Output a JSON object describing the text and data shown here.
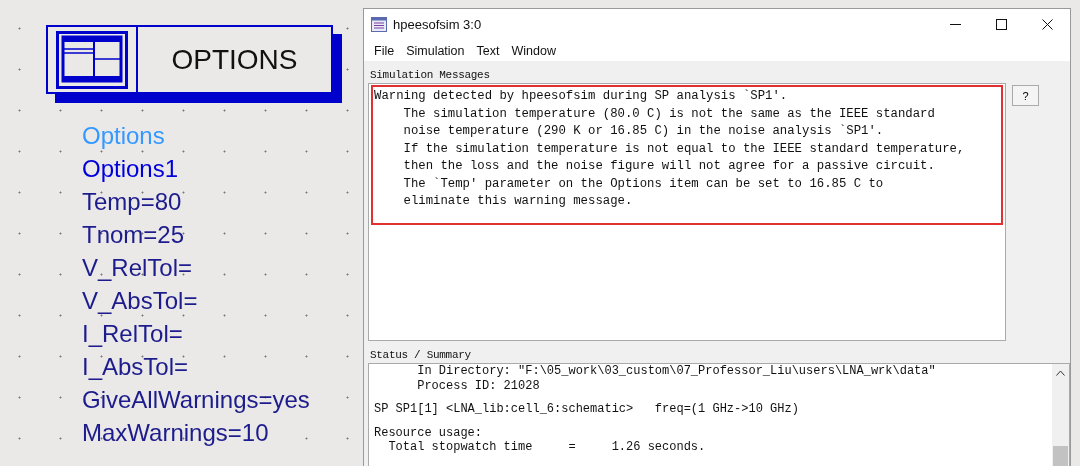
{
  "canvas": {
    "component": {
      "title": "OPTIONS"
    },
    "parameters": [
      {
        "text": "Options",
        "color": "#3399ff"
      },
      {
        "text": "Options1",
        "color": "#0000dd"
      },
      {
        "text": "Temp=80",
        "color": "#1c1c8c"
      },
      {
        "text": "Tnom=25",
        "color": "#1c1c8c"
      },
      {
        "text": "V_RelTol=",
        "color": "#1c1c8c"
      },
      {
        "text": "V_AbsTol=",
        "color": "#1c1c8c"
      },
      {
        "text": "I_RelTol=",
        "color": "#1c1c8c"
      },
      {
        "text": "I_AbsTol=",
        "color": "#1c1c8c"
      },
      {
        "text": "GiveAllWarnings=yes",
        "color": "#1c1c8c"
      },
      {
        "text": "MaxWarnings=10",
        "color": "#1c1c8c"
      }
    ]
  },
  "window": {
    "title": "hpeesofsim 3:0",
    "menu": [
      "File",
      "Simulation",
      "Text",
      "Window"
    ],
    "messages": {
      "label": "Simulation Messages",
      "highlighted": true,
      "help_button": "?",
      "lines": [
        "Warning detected by hpeesofsim during SP analysis `SP1'.",
        "    The simulation temperature (80.0 C) is not the same as the IEEE standard",
        "    noise temperature (290 K or 16.85 C) in the noise analysis `SP1'.",
        "    If the simulation temperature is not equal to the IEEE standard temperature,",
        "    then the loss and the noise figure will not agree for a passive circuit.",
        "    The `Temp' parameter on the Options item can be set to 16.85 C to",
        "    eliminate this warning message."
      ]
    },
    "status": {
      "label": "Status / Summary",
      "blocks": [
        {
          "lines": [
            "      In Directory: \"F:\\05_work\\03_custom\\07_Professor_Liu\\users\\LNA_wrk\\data\"",
            "      Process ID: 21028"
          ]
        },
        {
          "lines": [
            "SP SP1[1] <LNA_lib:cell_6:schematic>   freq=(1 GHz->10 GHz)"
          ]
        },
        {
          "lines": [
            "Resource usage:",
            "  Total stopwatch time     =     1.26 seconds."
          ]
        }
      ]
    }
  }
}
